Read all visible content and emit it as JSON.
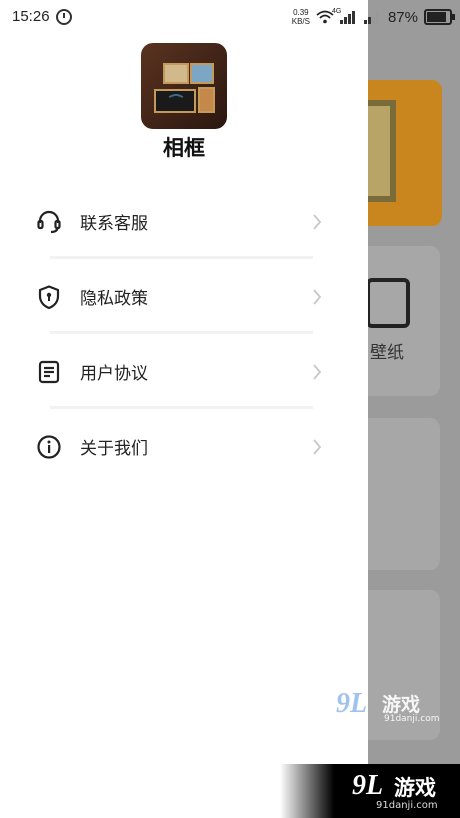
{
  "status_bar": {
    "time": "15:26",
    "net_speed_value": "0.39",
    "net_speed_unit": "KB/S",
    "network_type": "4G",
    "battery_percent": "87%"
  },
  "drawer": {
    "app_name": "相框",
    "menu": [
      {
        "label": "联系客服",
        "icon": "headset-icon"
      },
      {
        "label": "隐私政策",
        "icon": "shield-icon"
      },
      {
        "label": "用户协议",
        "icon": "document-icon"
      },
      {
        "label": "关于我们",
        "icon": "info-icon"
      }
    ]
  },
  "background": {
    "tile_label": "壁纸"
  },
  "watermark": {
    "mark": "9L",
    "name": "游戏",
    "url": "91danji.com"
  },
  "colors": {
    "drawer_bg": "#ffffff",
    "scrim": "#9b9b9b",
    "banner": "#c9861f"
  }
}
